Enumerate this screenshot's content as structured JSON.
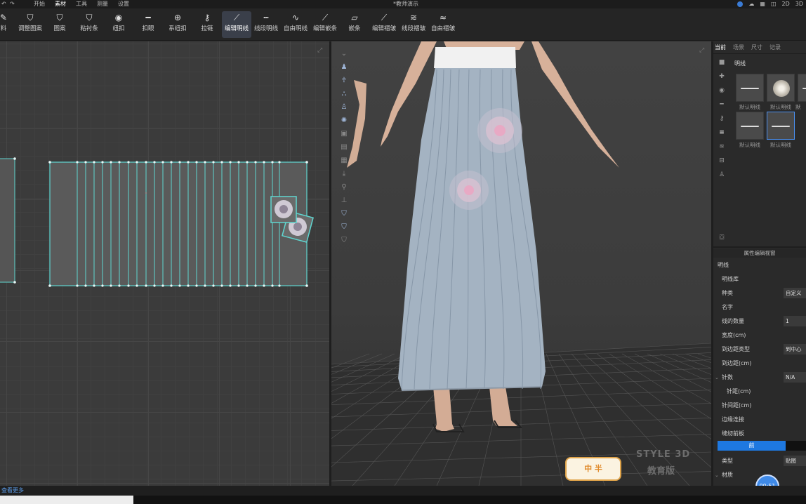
{
  "menubar": {
    "items": [
      "开始",
      "素材",
      "工具",
      "测量",
      "设置"
    ],
    "doc_title": "*教师演示",
    "notification_count": "1",
    "view_2d": "2D",
    "view_3d": "3D"
  },
  "toolbar": {
    "tools": [
      {
        "label": "料",
        "icon": "fabric-icon"
      },
      {
        "label": "调整图案",
        "icon": "adjust-graphic-icon"
      },
      {
        "label": "图案",
        "icon": "graphic-icon"
      },
      {
        "label": "粘衬条",
        "icon": "tape-icon"
      },
      {
        "label": "纽扣",
        "icon": "button-icon"
      },
      {
        "label": "扣眼",
        "icon": "buttonhole-icon"
      },
      {
        "label": "系纽扣",
        "icon": "fasten-icon"
      },
      {
        "label": "拉链",
        "icon": "zipper-icon"
      },
      {
        "label": "编辑明线",
        "icon": "topstitch-icon",
        "active": true
      },
      {
        "label": "线段明线",
        "icon": "segment-stitch-icon"
      },
      {
        "label": "自由明线",
        "icon": "free-stitch-icon"
      },
      {
        "label": "编辑嵌条",
        "icon": "piping-icon"
      },
      {
        "label": "嵌条",
        "icon": "piping-add-icon"
      },
      {
        "label": "编辑褶皱",
        "icon": "pucker-icon"
      },
      {
        "label": "线段褶皱",
        "icon": "segment-pucker-icon"
      },
      {
        "label": "自由褶皱",
        "icon": "free-pucker-icon"
      }
    ]
  },
  "library": {
    "tabs": [
      "当前",
      "场景",
      "尺寸",
      "记录"
    ],
    "section_title": "明线",
    "thumbnails": [
      {
        "label": "默认明线",
        "kind": "line"
      },
      {
        "label": "默认明线",
        "kind": "flower"
      },
      {
        "label": "默",
        "kind": "line"
      },
      {
        "label": "默认明线",
        "kind": "line"
      },
      {
        "label": "默认明线",
        "kind": "line",
        "selected": true
      }
    ]
  },
  "properties": {
    "header": "属性编辑视窗",
    "rows": [
      {
        "key": "明线",
        "value": null,
        "indent": 0
      },
      {
        "key": "明线库",
        "value": null,
        "indent": 1
      },
      {
        "key": "种类",
        "value": "自定义",
        "indent": 1
      },
      {
        "key": "名字",
        "value": null,
        "indent": 1
      },
      {
        "key": "线的数量",
        "value": "1",
        "indent": 1
      },
      {
        "key": "宽度(cm)",
        "value": null,
        "indent": 1
      },
      {
        "key": "到边距类型",
        "value": "到中心",
        "indent": 1
      },
      {
        "key": "到边距(cm)",
        "value": null,
        "indent": 1
      },
      {
        "key": "针数",
        "value": "N/A",
        "indent": 1
      },
      {
        "key": "针距(cm)",
        "value": null,
        "indent": 2
      },
      {
        "key": "针间距(cm)",
        "value": null,
        "indent": 1
      },
      {
        "key": "边缘连接",
        "value": null,
        "indent": 1
      },
      {
        "key": "缝纫前板",
        "value": null,
        "indent": 1
      }
    ],
    "tab_front": "前",
    "type_key": "类型",
    "type_value": "贴图",
    "material_key": "材质"
  },
  "timer": "00:51",
  "statusbar": {
    "link": "查看更多"
  },
  "watermark": {
    "line1": "STYLE 3D",
    "line2": "教育版"
  },
  "sticker": "中 半",
  "colors": {
    "accent": "#1e78e0",
    "pattern_outline": "#5fd6d0",
    "skirt": "#a4b3c2",
    "waistband": "#f1f1f1"
  }
}
